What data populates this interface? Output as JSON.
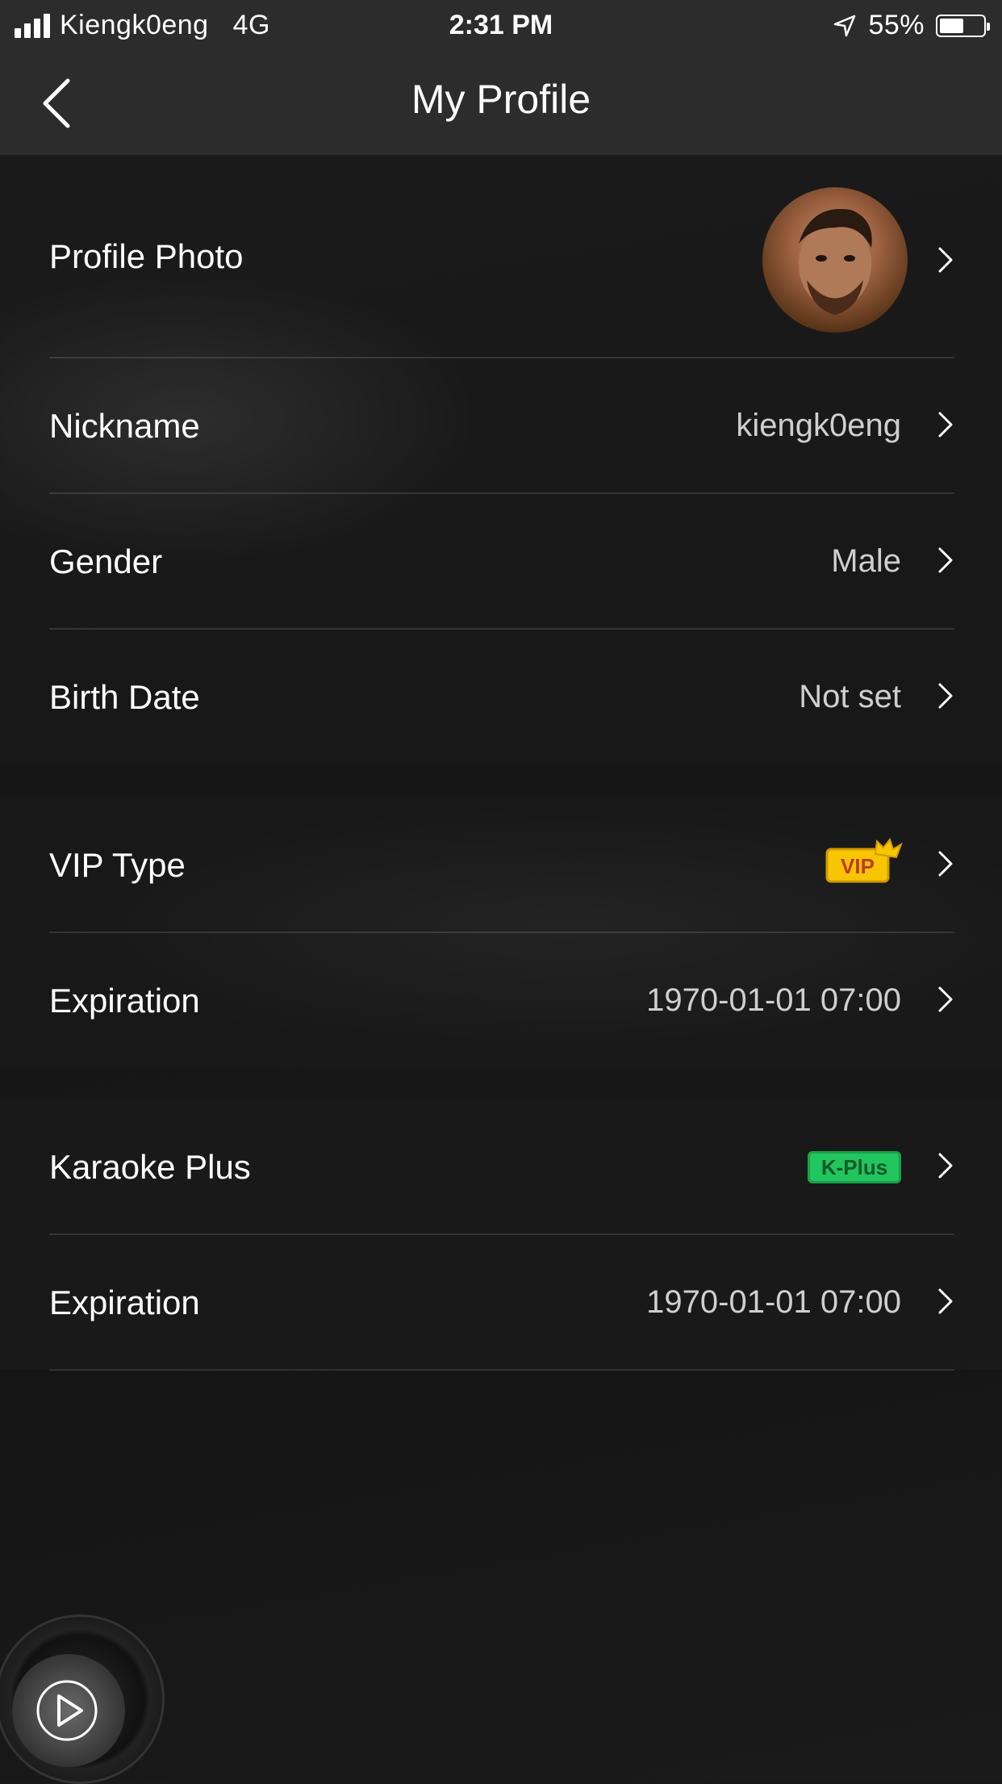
{
  "status_bar": {
    "carrier": "Kiengk0eng",
    "network": "4G",
    "time": "2:31 PM",
    "battery_percent_text": "55%",
    "battery_level": 0.55
  },
  "nav": {
    "back_icon": "chevron-left-icon",
    "title": "My Profile"
  },
  "profile": {
    "photo_label": "Profile Photo",
    "nickname_label": "Nickname",
    "nickname_value": "kiengk0eng",
    "gender_label": "Gender",
    "gender_value": "Male",
    "birth_label": "Birth Date",
    "birth_value": "Not set"
  },
  "vip": {
    "type_label": "VIP Type",
    "badge_text": "VIP",
    "expiration_label": "Expiration",
    "expiration_value": "1970-01-01 07:00"
  },
  "karaoke": {
    "label": "Karaoke Plus",
    "badge_text": "K-Plus",
    "expiration_label": "Expiration",
    "expiration_value": "1970-01-01 07:00"
  },
  "colors": {
    "vip_badge": "#f7c600",
    "kplus_badge": "#22c55e",
    "background": "#151515",
    "header": "#2c2c2c"
  }
}
